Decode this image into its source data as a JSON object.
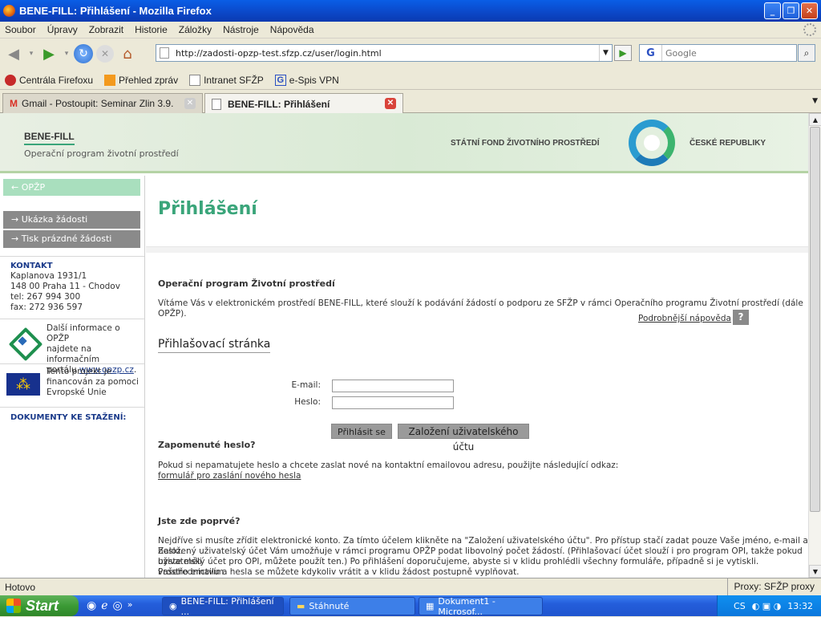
{
  "window": {
    "title": "BENE-FILL: Přihlášení - Mozilla Firefox"
  },
  "menu": [
    "Soubor",
    "Úpravy",
    "Zobrazit",
    "Historie",
    "Záložky",
    "Nástroje",
    "Nápověda"
  ],
  "nav": {
    "url": "http://zadosti-opzp-test.sfzp.cz/user/login.html",
    "search_placeholder": "Google",
    "search_engine": "G"
  },
  "bookmarks": [
    "Centrála Firefoxu",
    "Přehled zpráv",
    "Intranet SFŽP",
    "e-Spis VPN"
  ],
  "tabs": [
    {
      "label": "Gmail - Postoupit: Seminar Zlin 3.9.",
      "active": false
    },
    {
      "label": "BENE-FILL: Přihlášení",
      "active": true
    }
  ],
  "header": {
    "brand": "BENE-FILL",
    "subtitle": "Operační program životní prostředí",
    "fund": "STÁTNÍ FOND ŽIVOTNÍHO PROSTŘEDÍ",
    "country": "ČESKÉ REPUBLIKY"
  },
  "sidebar": {
    "opzp": "← OPŽP",
    "links": [
      "→ Ukázka žádosti",
      "→ Tisk prázdné žádosti"
    ],
    "kontakt": {
      "heading": "KONTAKT",
      "lines": [
        "Kaplanova 1931/1",
        "148 00 Praha 11 - Chodov",
        "tel: 267 994 300",
        "fax: 272 936 597"
      ]
    },
    "opzp_info": {
      "line1": "Další informace o OPŽP",
      "line2": "najdete na informačním",
      "line3": "portálu",
      "link": "www.opzp.cz",
      "tail": "."
    },
    "eu_info": {
      "line1": "Tento projekt je",
      "line2": "financován za pomoci",
      "line3": "Evropské Unie"
    },
    "documents": "DOKUMENTY KE STAŽENÍ:"
  },
  "main": {
    "title": "Přihlášení",
    "section1_heading": "Operační program Životní prostředí",
    "intro": "Vítáme Vás v elektronickém prostředí BENE-FILL, které slouží k podávání žádostí o podporu ze SFŽP v rámci Operačního programu Životní prostředí (dále OPŽP).",
    "help_link": "Podrobnější nápověda",
    "help_q": "?",
    "login_heading": "Přihlašovací stránka",
    "email_label": "E-mail:",
    "password_label": "Heslo:",
    "login_button": "Přihlásit se",
    "register_button": "Založení uživatelského účtu",
    "forgot_heading": "Zapomenuté heslo?",
    "forgot_text": "Pokud si nepamatujete heslo a chcete zaslat nové na kontaktní emailovou adresu, použijte následující odkaz:",
    "forgot_link": "formulář pro zaslání nového hesla",
    "first_heading": "Jste zde poprvé?",
    "first_text1": "Nejdříve si musíte zřídit elektronické konto. Za tímto účelem klikněte na \"Založení uživatelského účtu\". Pro přístup stačí zadat pouze Vaše jméno, e-mail a heslo.",
    "first_text2": "Založený uživatelský účet Vám umožňuje v rámci programu OPŽP podat libovolný počet žádostí. (Přihlašovací účet slouží i pro program OPI, takže pokud byste měli",
    "first_text3": "uživatelský účet pro OPI, můžete použít ten.) Po přihlášení doporučujeme, abyste si v klidu prohlédli všechny formuláře, případně si je vytiskli. Prostřednictvím",
    "first_text4": "vašeho emailu a hesla se můžete kdykoliv vrátit a v klidu žádost postupně vyplňovat."
  },
  "status": {
    "text": "Hotovo",
    "proxy": "Proxy: SFŽP proxy"
  },
  "taskbar": {
    "start": "Start",
    "items": [
      "BENE-FILL: Přihlášení ...",
      "Stáhnuté",
      "Dokument1 - Microsof..."
    ],
    "lang": "CS",
    "time": "13:32"
  }
}
